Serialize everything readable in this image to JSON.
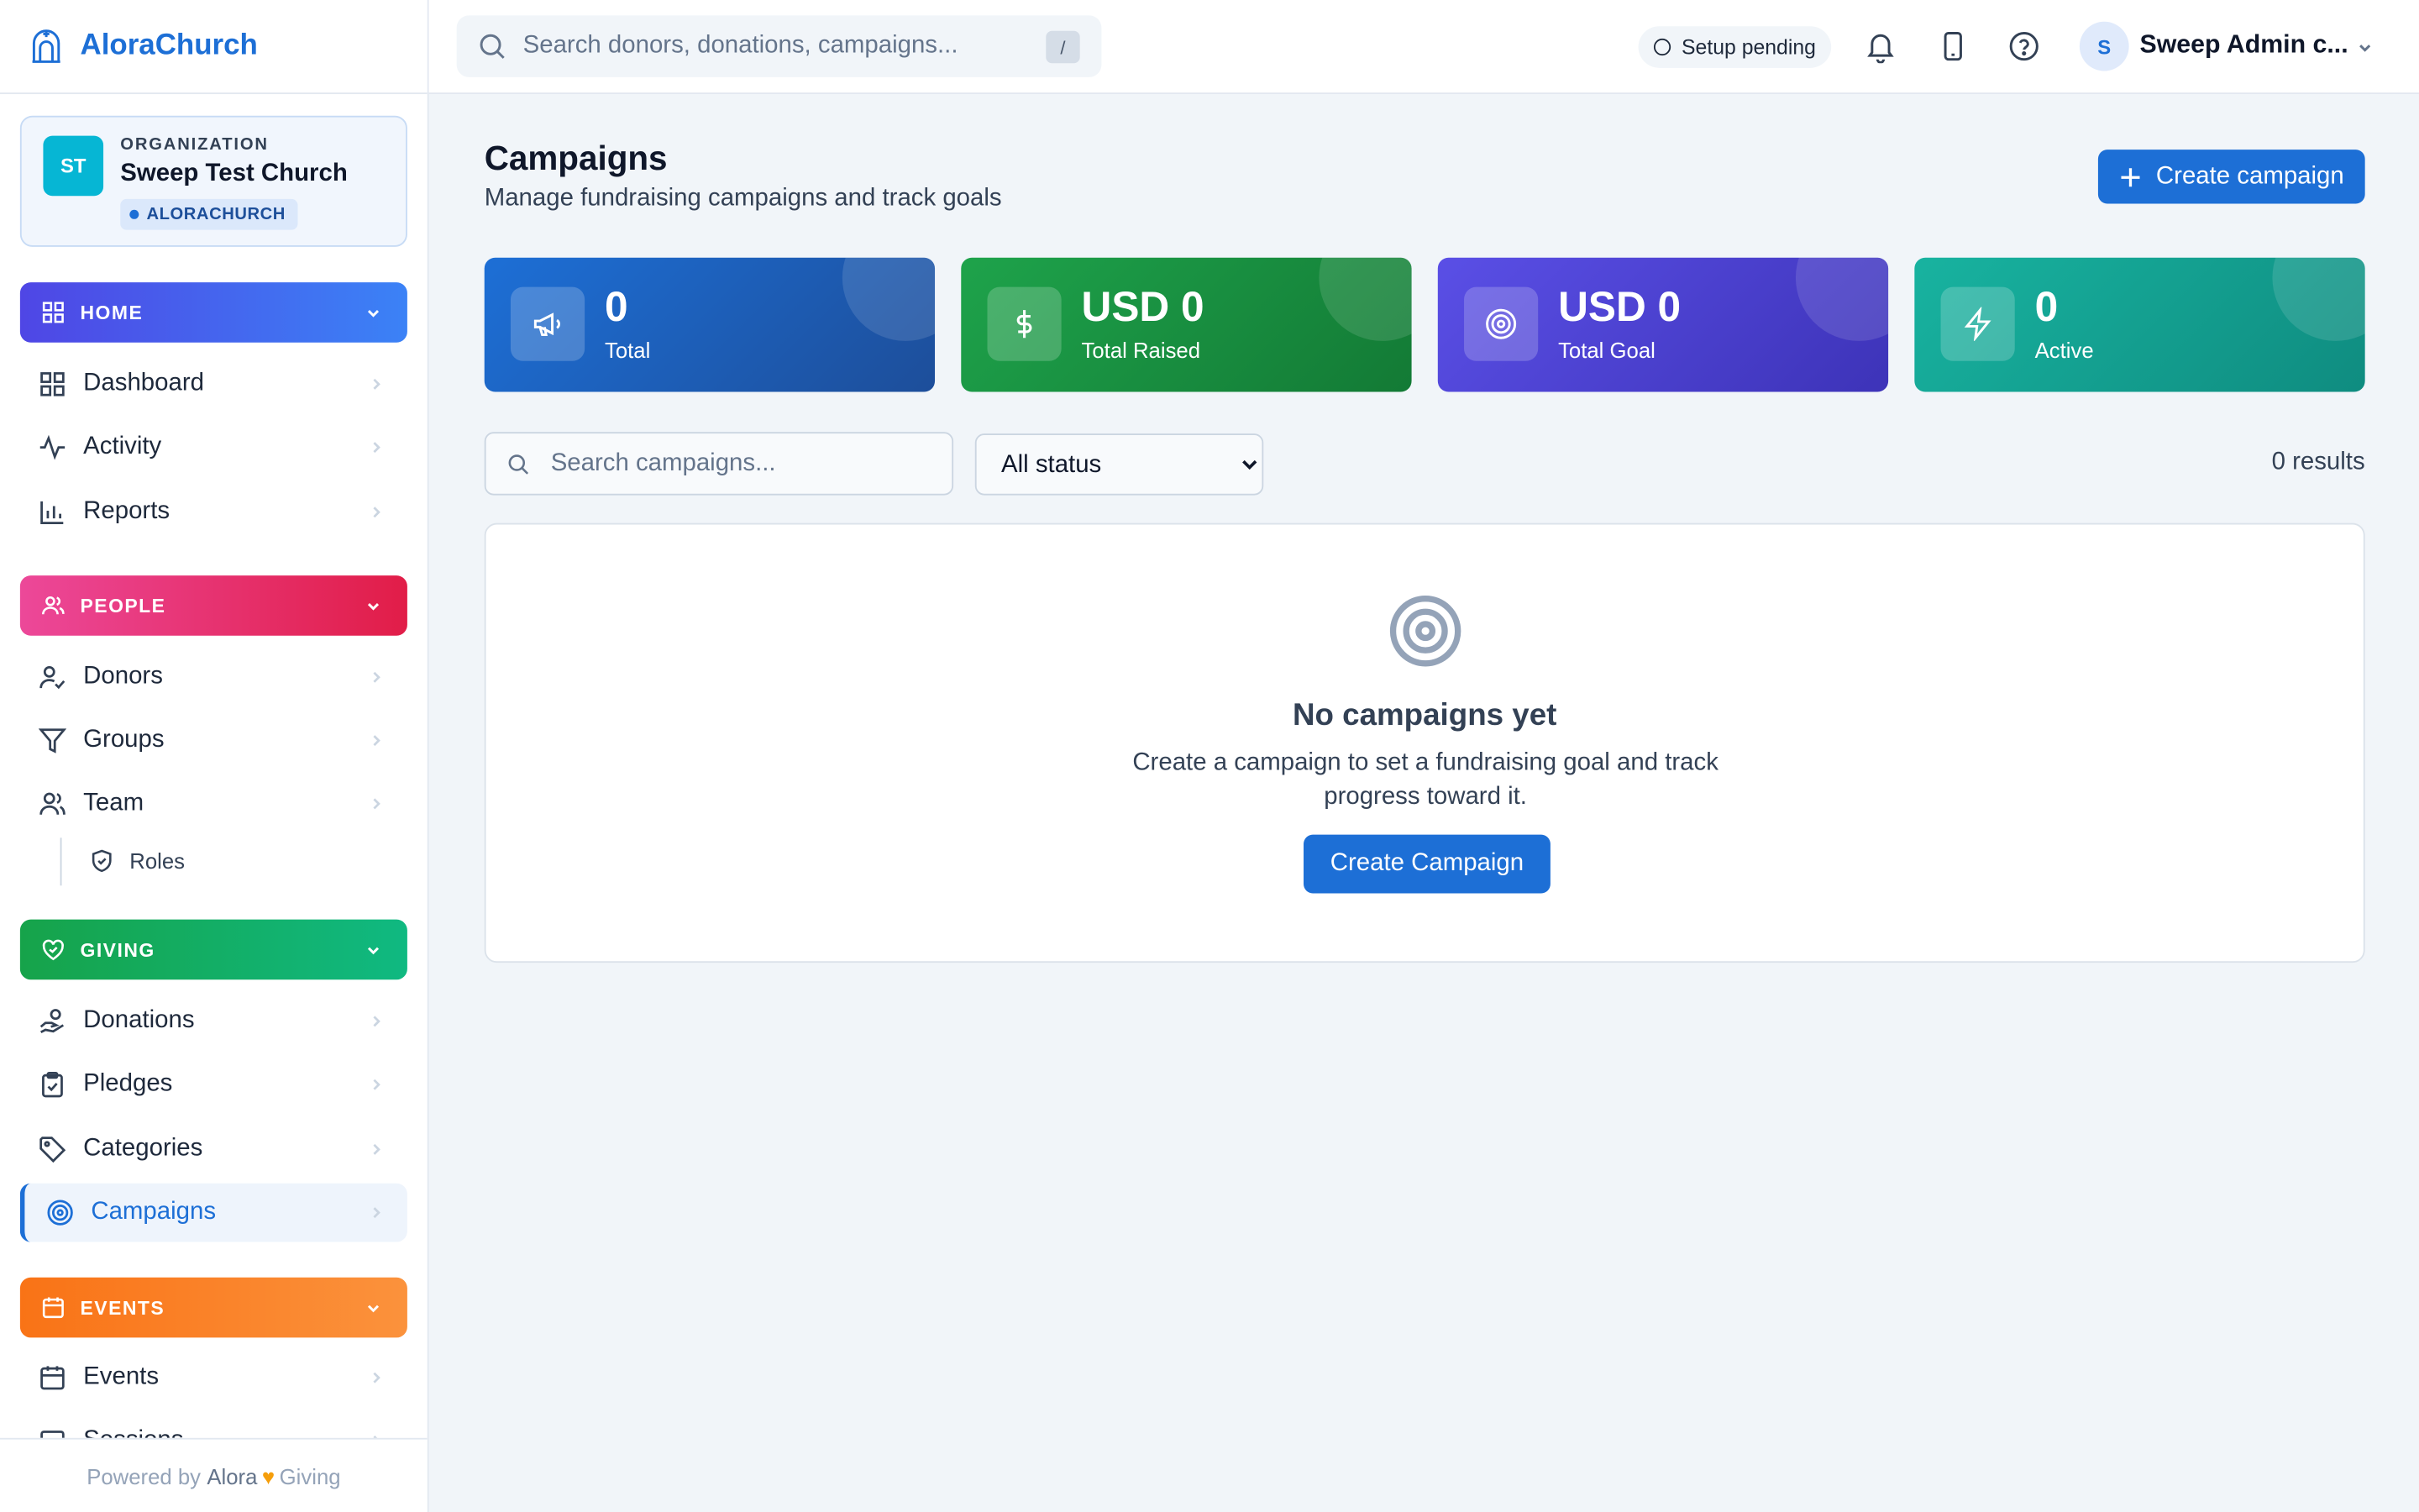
{
  "app": {
    "name": "AloraChurch"
  },
  "org": {
    "initials": "ST",
    "caption": "ORGANIZATION",
    "name": "Sweep Test Church",
    "badge": "ALORACHURCH"
  },
  "sidebar": {
    "sections": {
      "home": {
        "label": "HOME",
        "color_from": "#4f46e5",
        "color_to": "#3b82f6"
      },
      "people": {
        "label": "PEOPLE",
        "color_from": "#ec4899",
        "color_to": "#e11d48"
      },
      "giving": {
        "label": "GIVING",
        "color_from": "#16a34a",
        "color_to": "#10b981"
      },
      "events": {
        "label": "EVENTS",
        "color_from": "#f97316",
        "color_to": "#fb923c"
      }
    },
    "items": {
      "dashboard": "Dashboard",
      "activity": "Activity",
      "reports": "Reports",
      "donors": "Donors",
      "groups": "Groups",
      "team": "Team",
      "roles": "Roles",
      "donations": "Donations",
      "pledges": "Pledges",
      "categories": "Categories",
      "campaigns": "Campaigns",
      "events": "Events",
      "sessions": "Sessions"
    },
    "active": "campaigns"
  },
  "footer": {
    "prefix": "Powered by",
    "brand_a": "Alora",
    "heart": "♥",
    "brand_b": "Giving"
  },
  "topbar": {
    "search_placeholder": "Search donors, donations, campaigns...",
    "shortcut": "/",
    "setup_status": "Setup pending",
    "user_initial": "S",
    "user_name": "Sweep Admin c...",
    "icons": [
      "bell-icon",
      "mobile-icon",
      "help-icon"
    ]
  },
  "main": {
    "title": "Campaigns",
    "subtitle": "Manage fundraising campaigns and track goals",
    "create_label": "Create campaign",
    "stats": [
      {
        "value": "0",
        "label": "Total",
        "icon": "megaphone-icon",
        "color": "#1d6fd6"
      },
      {
        "value": "USD 0",
        "label": "Total Raised",
        "icon": "dollar-icon",
        "color": "#16a34a"
      },
      {
        "value": "USD 0",
        "label": "Total Goal",
        "icon": "target-icon",
        "color": "#4f46e5"
      },
      {
        "value": "0",
        "label": "Active",
        "icon": "bolt-icon",
        "color": "#14b8a6"
      }
    ],
    "filter": {
      "search_placeholder": "Search campaigns...",
      "status_selected": "All status",
      "results": "0 results"
    },
    "empty": {
      "title": "No campaigns yet",
      "description": "Create a campaign to set a fundraising goal and track progress toward it.",
      "button": "Create Campaign"
    }
  }
}
